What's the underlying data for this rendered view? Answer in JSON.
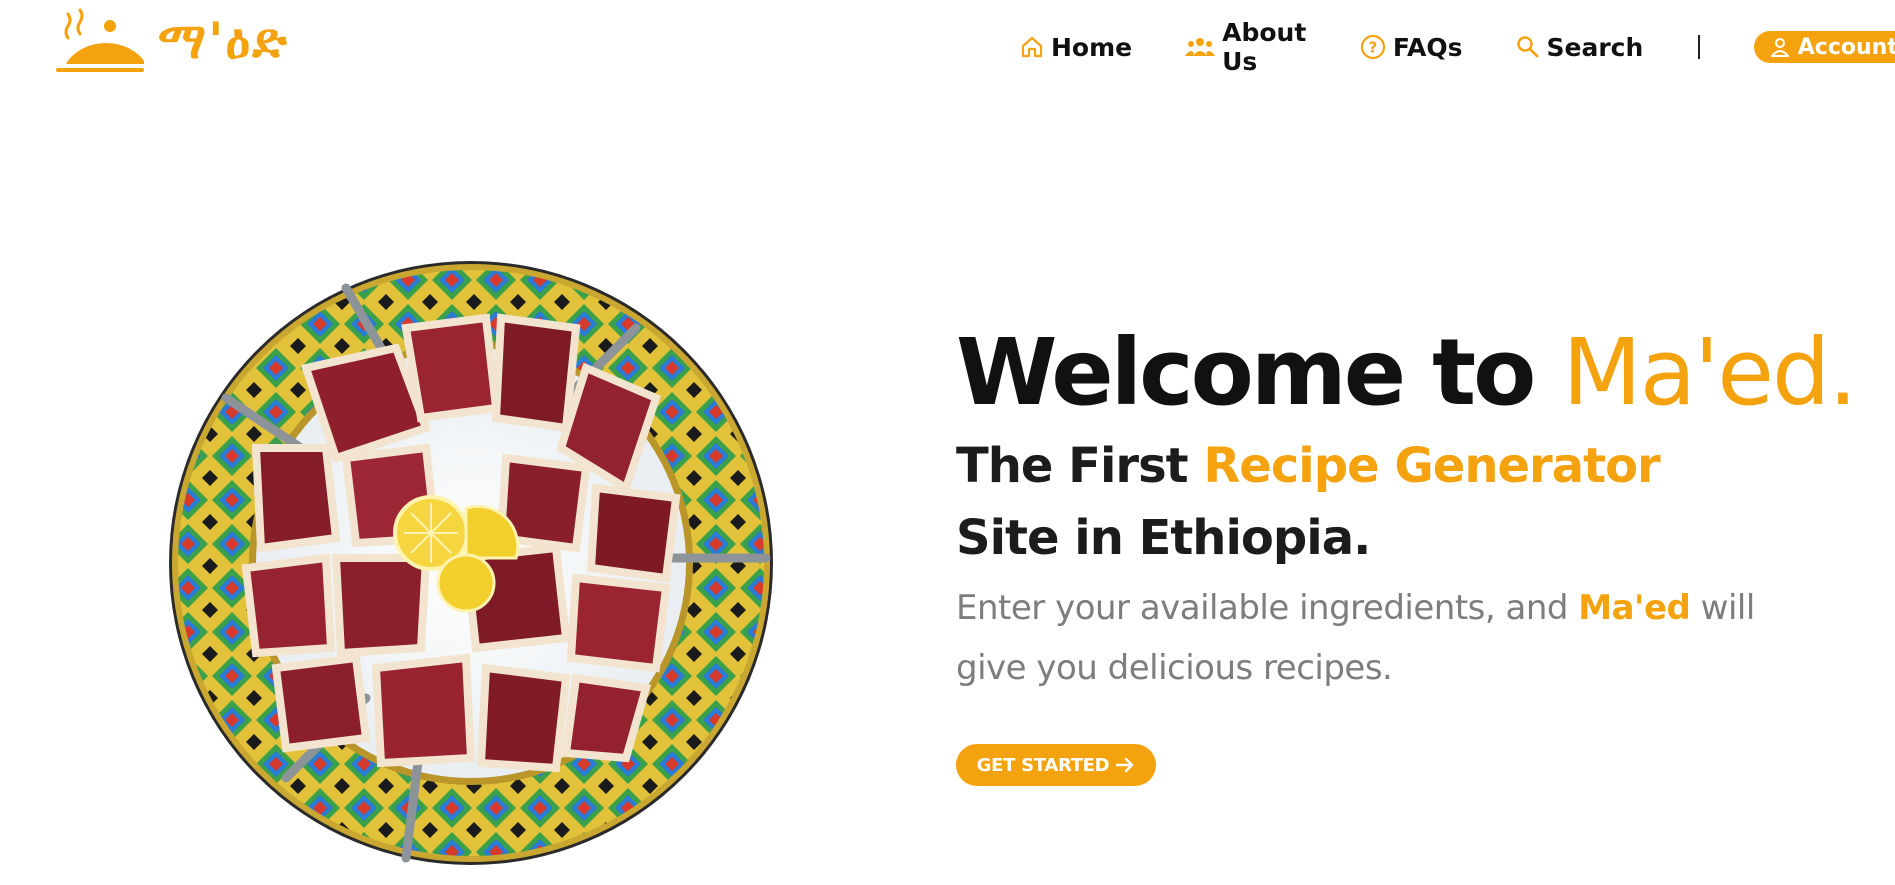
{
  "brand": {
    "logo_text": "ማ'ዕድ",
    "accent_color": "#f5a20f"
  },
  "nav": {
    "items": [
      {
        "label": "Home",
        "icon": "home-icon"
      },
      {
        "label": "About Us",
        "icon": "users-icon"
      },
      {
        "label": "FAQs",
        "icon": "question-circle-icon"
      },
      {
        "label": "Search",
        "icon": "search-icon"
      }
    ],
    "account_label": "Account",
    "account_icon": "user-icon"
  },
  "hero": {
    "title_prefix": "Welcome to ",
    "title_accent": "Ma'ed.",
    "sub_prefix": "The First ",
    "sub_accent": "Recipe Generator",
    "sub_suffix": " Site in Ethiopia.",
    "desc_prefix": "Enter your available ingredients, and ",
    "desc_accent": "Ma'ed",
    "desc_suffix": " will give you delicious recipes.",
    "cta_label": "GET STARTED",
    "cta_icon": "arrow-right-icon",
    "image_subject": "raw beef pieces with lemon on a decorative Ethiopian plate"
  }
}
